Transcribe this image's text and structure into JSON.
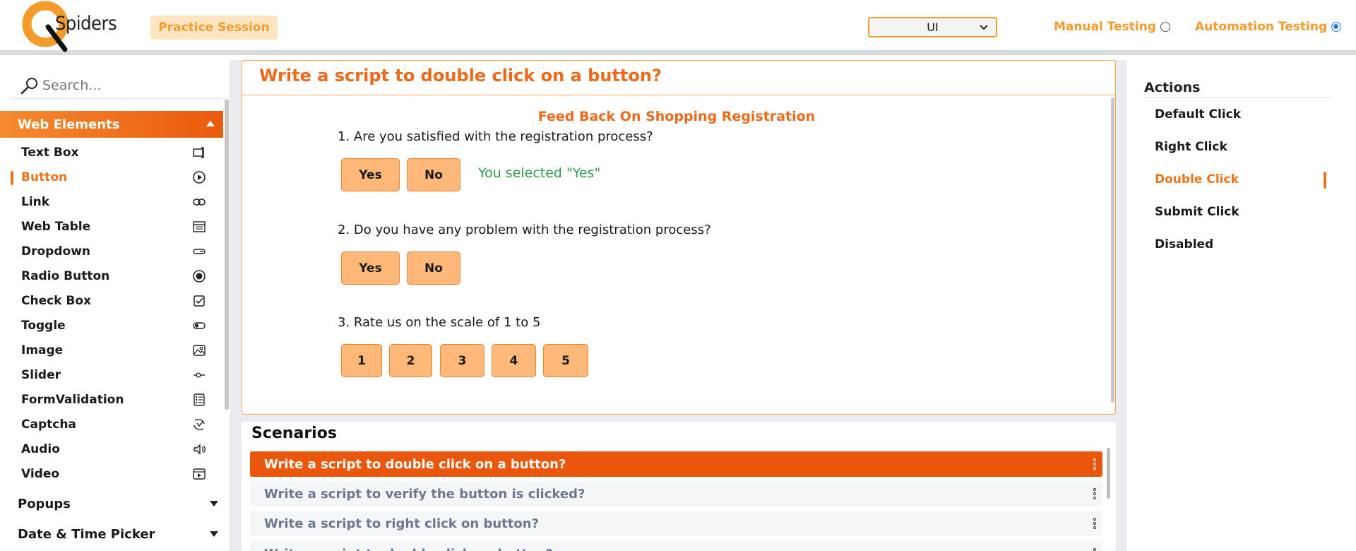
{
  "header": {
    "logo_text": "Spiders",
    "practice_label": "Practice Session",
    "mode_select": "UI",
    "radio_manual": "Manual Testing",
    "radio_automation": "Automation Testing"
  },
  "sidebar": {
    "search_placeholder": "Search...",
    "active_category": "Web Elements",
    "items": [
      {
        "label": "Text Box",
        "icon": "textbox-icon"
      },
      {
        "label": "Button",
        "icon": "play-circle-icon"
      },
      {
        "label": "Link",
        "icon": "link-icon"
      },
      {
        "label": "Web Table",
        "icon": "table-icon"
      },
      {
        "label": "Dropdown",
        "icon": "dropdown-icon"
      },
      {
        "label": "Radio Button",
        "icon": "radio-icon"
      },
      {
        "label": "Check Box",
        "icon": "checkbox-icon"
      },
      {
        "label": "Toggle",
        "icon": "toggle-icon"
      },
      {
        "label": "Image",
        "icon": "image-icon"
      },
      {
        "label": "Slider",
        "icon": "slider-icon"
      },
      {
        "label": "FormValidation",
        "icon": "form-icon"
      },
      {
        "label": "Captcha",
        "icon": "captcha-icon"
      },
      {
        "label": "Audio",
        "icon": "audio-icon"
      },
      {
        "label": "Video",
        "icon": "video-icon"
      }
    ],
    "categories": [
      "Popups",
      "Date & Time Picker"
    ]
  },
  "question": {
    "title": "Write a script to double click on a button?",
    "feedback_title": "Feed Back On Shopping Registration",
    "q1": "1. Are you satisfied with the registration process?",
    "q2": "2. Do you have any problem with the registration process?",
    "q3": "3. Rate us on the scale of 1 to 5",
    "yes": "Yes",
    "no": "No",
    "ratings": [
      "1",
      "2",
      "3",
      "4",
      "5"
    ],
    "selected_message": "You selected \"Yes\""
  },
  "scenarios": {
    "title": "Scenarios",
    "rows": [
      "Write a script to double click on a button?",
      "Write a script to verify the button is clicked?",
      "Write a script to right click on button?",
      "Write a script to double click on button?"
    ]
  },
  "actions": {
    "title": "Actions",
    "items": [
      "Default Click",
      "Right Click",
      "Double Click",
      "Submit Click",
      "Disabled"
    ]
  },
  "colors": {
    "accent": "#f0731a",
    "button_fill": "#fdb87a",
    "success": "#2e9a4a",
    "radio_selected": "#2a7ad9"
  }
}
